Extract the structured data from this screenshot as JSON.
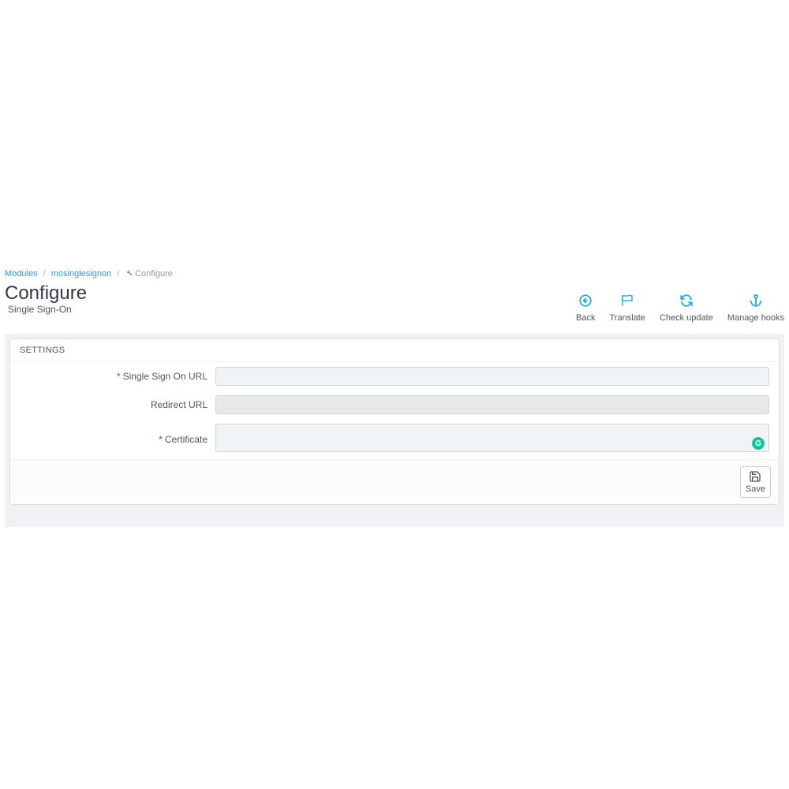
{
  "breadcrumb": {
    "modules": "Modules",
    "module_name": "mosinglesignon",
    "current": "Configure"
  },
  "header": {
    "title": "Configure",
    "subtitle": "Single Sign-On"
  },
  "toolbar": {
    "back": "Back",
    "translate": "Translate",
    "check_update": "Check update",
    "manage_hooks": "Manage hooks"
  },
  "panel": {
    "heading": "SETTINGS",
    "fields": {
      "sso_url": {
        "label": "Single Sign On URL",
        "required": true,
        "value": ""
      },
      "redirect_url": {
        "label": "Redirect URL",
        "required": false,
        "value": ""
      },
      "certificate": {
        "label": "Certificate",
        "required": true,
        "value": ""
      }
    },
    "save_label": "Save"
  }
}
